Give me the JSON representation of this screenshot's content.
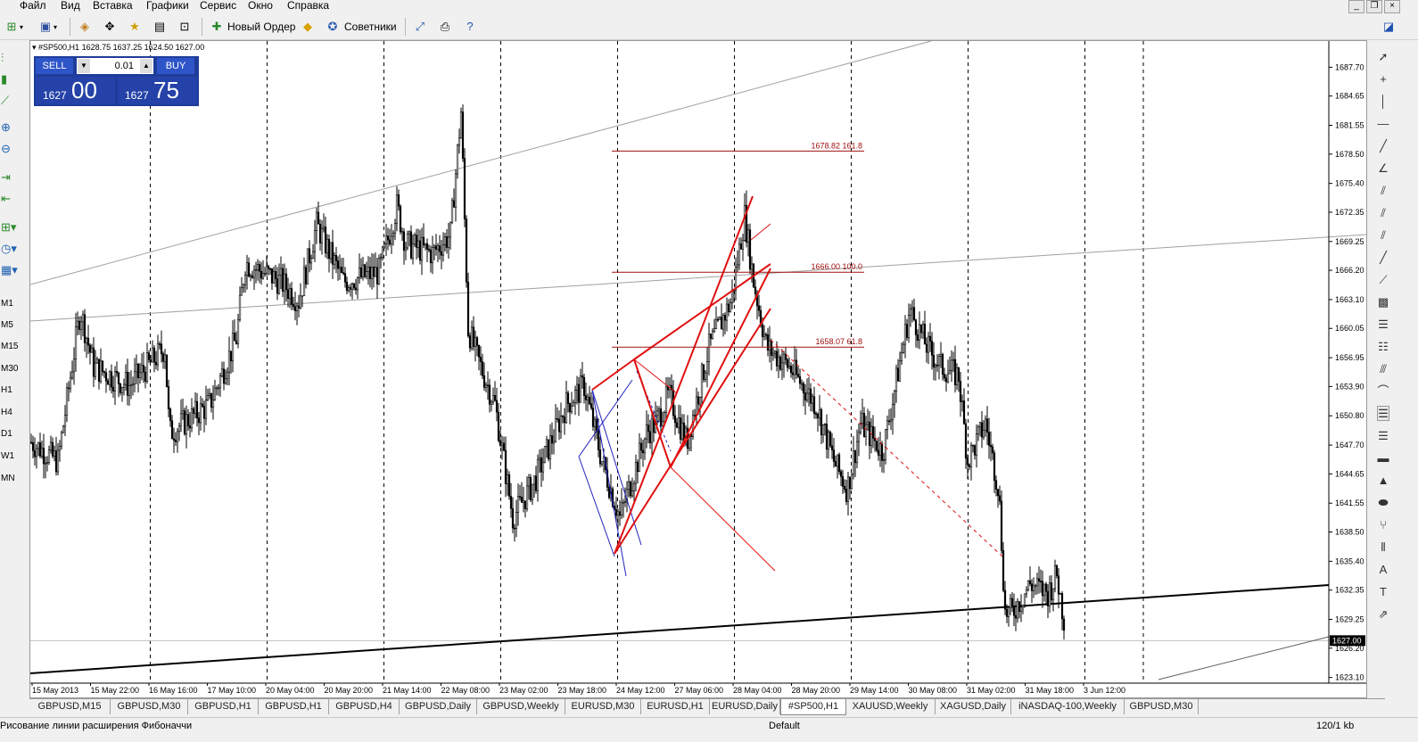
{
  "menu": {
    "items": [
      "Файл",
      "Вид",
      "Вставка",
      "Графики",
      "Сервис",
      "Окно",
      "Справка"
    ]
  },
  "toolbar": {
    "new_order_label": "Новый Ордер",
    "advisors_label": "Советники"
  },
  "timeframes": [
    "M1",
    "M5",
    "M15",
    "M30",
    "H1",
    "H4",
    "D1",
    "W1",
    "MN"
  ],
  "chart_header": {
    "text": "#SP500,H1  1628.75 1637.25 1624.50 1627.00"
  },
  "trade_panel": {
    "sell_label": "SELL",
    "buy_label": "BUY",
    "lot": "0.01",
    "sell_price_prefix": "1627",
    "sell_price_big": "00",
    "buy_price_prefix": "1627",
    "buy_price_big": "75"
  },
  "fibo_labels": [
    "1678.82  161.8",
    "1666.00  100.0",
    "1658.07  61.8"
  ],
  "current_price_label": "1627.00",
  "chart_data": {
    "type": "candlestick",
    "symbol": "#SP500",
    "timeframe": "H1",
    "ohlc_last": {
      "open": 1628.75,
      "high": 1637.25,
      "low": 1624.5,
      "close": 1627.0
    },
    "y_ticks": [
      "1687.70",
      "1684.65",
      "1681.55",
      "1678.50",
      "1675.40",
      "1672.35",
      "1669.25",
      "1666.20",
      "1663.10",
      "1660.05",
      "1656.95",
      "1653.90",
      "1650.80",
      "1647.70",
      "1644.65",
      "1641.55",
      "1638.50",
      "1635.40",
      "1632.35",
      "1629.25",
      "1626.20",
      "1623.10"
    ],
    "ylim": [
      1622.5,
      1690
    ],
    "x_ticks": [
      "15 May 2013",
      "15 May 22:00",
      "16 May 16:00",
      "17 May 10:00",
      "20 May 04:00",
      "20 May 20:00",
      "21 May 14:00",
      "22 May 08:00",
      "23 May 02:00",
      "23 May 18:00",
      "24 May 12:00",
      "27 May 06:00",
      "28 May 04:00",
      "28 May 20:00",
      "29 May 14:00",
      "30 May 08:00",
      "31 May 02:00",
      "31 May 18:00",
      "3 Jun 12:00"
    ],
    "fibo_levels": [
      {
        "price": 1678.82,
        "ratio": "161.8"
      },
      {
        "price": 1666.0,
        "ratio": "100.0"
      },
      {
        "price": 1658.07,
        "ratio": "61.8"
      }
    ],
    "current_price": 1627.0,
    "grid": "vertical-dashed"
  },
  "tabs": [
    "GBPUSD,M15",
    "GBPUSD,M30",
    "GBPUSD,H1",
    "GBPUSD,H1",
    "GBPUSD,H4",
    "GBPUSD,Daily",
    "GBPUSD,Weekly",
    "EURUSD,M30",
    "EURUSD,H1",
    "EURUSD,Daily",
    "#SP500,H1",
    "XAUUSD,Weekly",
    "XAGUSD,Daily",
    "iNASDAQ-100,Weekly",
    "GBPUSD,M30"
  ],
  "active_tab": "#SP500,H1",
  "status": {
    "hint": "Рисование линии расширения Фибоначчи",
    "profile": "Default",
    "traffic": "120/1 kb"
  }
}
